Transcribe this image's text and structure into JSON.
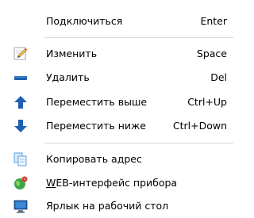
{
  "menu": {
    "items": [
      {
        "label": "Подключиться",
        "shortcut": "Enter",
        "icon": "none"
      },
      {
        "label": "Изменить",
        "shortcut": "Space",
        "icon": "pencil-icon"
      },
      {
        "label": "Удалить",
        "shortcut": "Del",
        "icon": "minus-bar-icon"
      },
      {
        "label": "Переместить выше",
        "shortcut": "Ctrl+Up",
        "icon": "arrow-up-icon"
      },
      {
        "label": "Переместить ниже",
        "shortcut": "Ctrl+Down",
        "icon": "arrow-down-icon"
      },
      {
        "label": "Копировать адрес",
        "shortcut": "",
        "icon": "copy-icon"
      },
      {
        "label_first_char": "W",
        "label_rest": "EB-интерфейс прибора",
        "shortcut": "",
        "icon": "web-globe-icon"
      },
      {
        "label": "Ярлык на рабочий стол",
        "shortcut": "",
        "icon": "desktop-shortcut-icon"
      }
    ]
  },
  "colors": {
    "blue_icon": "#1f5fb0",
    "blue_light": "#3a8ad8",
    "pencil_yellow": "#f2c24a",
    "pencil_red": "#d9574a",
    "copy_blue": "#5aa0e0",
    "globe_green": "#3aa64a",
    "globe_red": "#d23a2a"
  }
}
